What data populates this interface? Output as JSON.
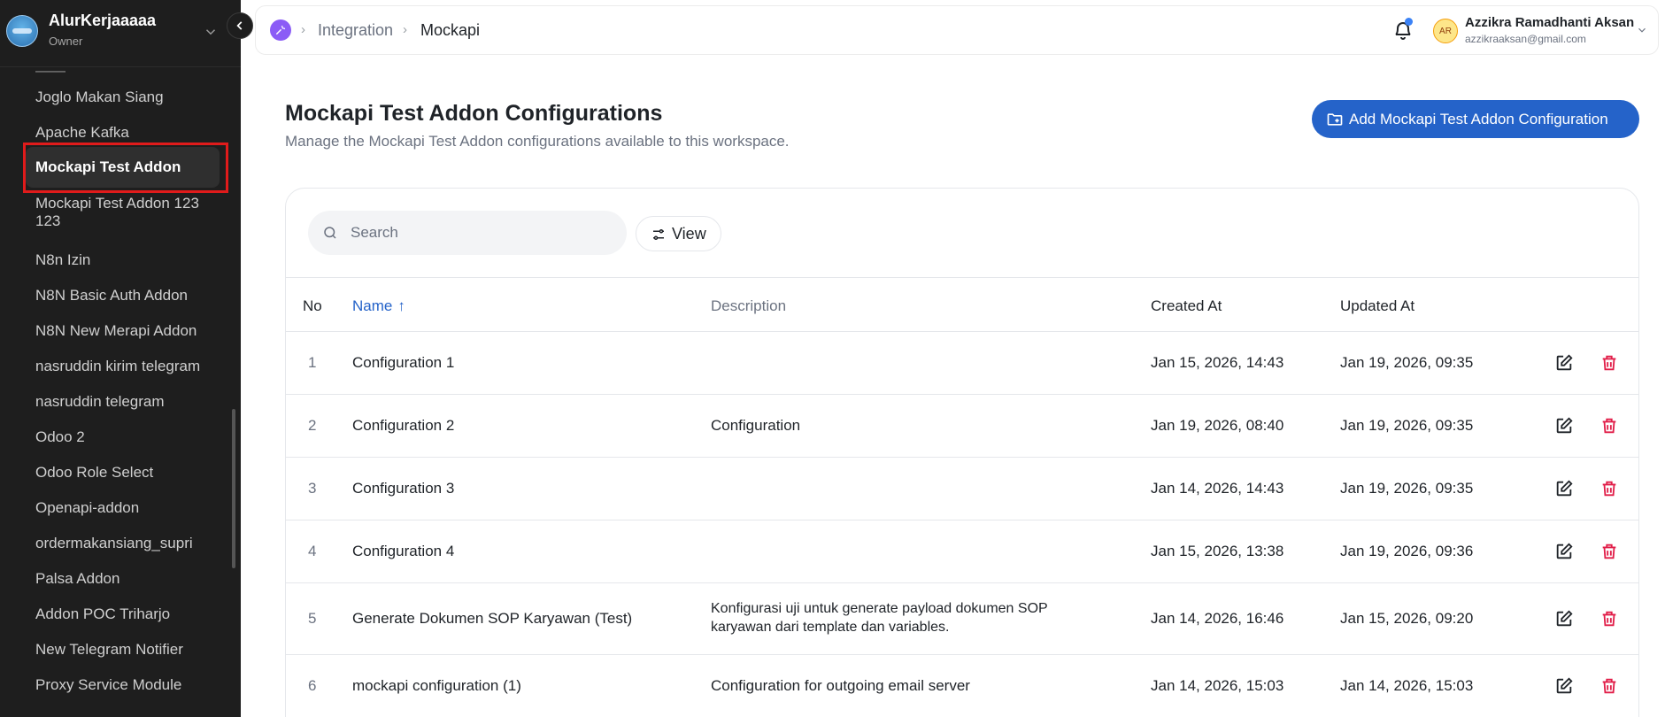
{
  "workspace": {
    "name": "AlurKerjaaaaa",
    "role": "Owner"
  },
  "sidebar": {
    "items": [
      {
        "label": "Joglo Makan Siang"
      },
      {
        "label": "Apache Kafka"
      },
      {
        "label": "Mockapi Test Addon",
        "active": true
      },
      {
        "label": "Mockapi Test Addon 123 123"
      },
      {
        "label": "N8n Izin"
      },
      {
        "label": "N8N Basic Auth Addon"
      },
      {
        "label": "N8N New Merapi Addon"
      },
      {
        "label": "nasruddin kirim telegram"
      },
      {
        "label": "nasruddin telegram"
      },
      {
        "label": "Odoo 2"
      },
      {
        "label": "Odoo Role Select"
      },
      {
        "label": "Openapi-addon"
      },
      {
        "label": "ordermakansiang_supri"
      },
      {
        "label": "Palsa Addon"
      },
      {
        "label": "Addon POC Triharjo"
      },
      {
        "label": "New Telegram Notifier"
      },
      {
        "label": "Proxy Service Module"
      }
    ]
  },
  "breadcrumb": {
    "icon": "integration-icon",
    "items": [
      "Integration",
      "Mockapi"
    ]
  },
  "user": {
    "initials": "AR",
    "name": "Azzikra Ramadhanti Aksan",
    "email": "azzikraaksan@gmail.com"
  },
  "page": {
    "title": "Mockapi Test Addon Configurations",
    "subtitle": "Manage the Mockapi Test Addon configurations available to this workspace.",
    "add_button": "Add Mockapi Test Addon Configuration"
  },
  "toolbar": {
    "search_placeholder": "Search",
    "view_label": "View"
  },
  "table": {
    "columns": {
      "no": "No",
      "name": "Name",
      "description": "Description",
      "created": "Created At",
      "updated": "Updated At"
    },
    "sort": {
      "column": "name",
      "direction": "asc"
    },
    "rows": [
      {
        "no": "1",
        "name": "Configuration 1",
        "description": "",
        "created": "Jan 15, 2026, 14:43",
        "updated": "Jan 19, 2026, 09:35"
      },
      {
        "no": "2",
        "name": "Configuration 2",
        "description": "Configuration",
        "created": "Jan 19, 2026, 08:40",
        "updated": "Jan 19, 2026, 09:35"
      },
      {
        "no": "3",
        "name": "Configuration 3",
        "description": "",
        "created": "Jan 14, 2026, 14:43",
        "updated": "Jan 19, 2026, 09:35"
      },
      {
        "no": "4",
        "name": "Configuration 4",
        "description": "",
        "created": "Jan 15, 2026, 13:38",
        "updated": "Jan 19, 2026, 09:36"
      },
      {
        "no": "5",
        "name": "Generate Dokumen SOP Karyawan (Test)",
        "description": "Konfigurasi uji untuk generate payload dokumen SOP karyawan dari template dan variables.",
        "created": "Jan 14, 2026, 16:46",
        "updated": "Jan 15, 2026, 09:20"
      },
      {
        "no": "6",
        "name": "mockapi configuration (1)",
        "description": "Configuration for outgoing email server",
        "created": "Jan 14, 2026, 15:03",
        "updated": "Jan 14, 2026, 15:03"
      }
    ]
  },
  "colors": {
    "accent": "#2563c9",
    "danger": "#e11d48",
    "sidebar_bg": "#1e1e1e",
    "highlight": "#e01b1b"
  }
}
